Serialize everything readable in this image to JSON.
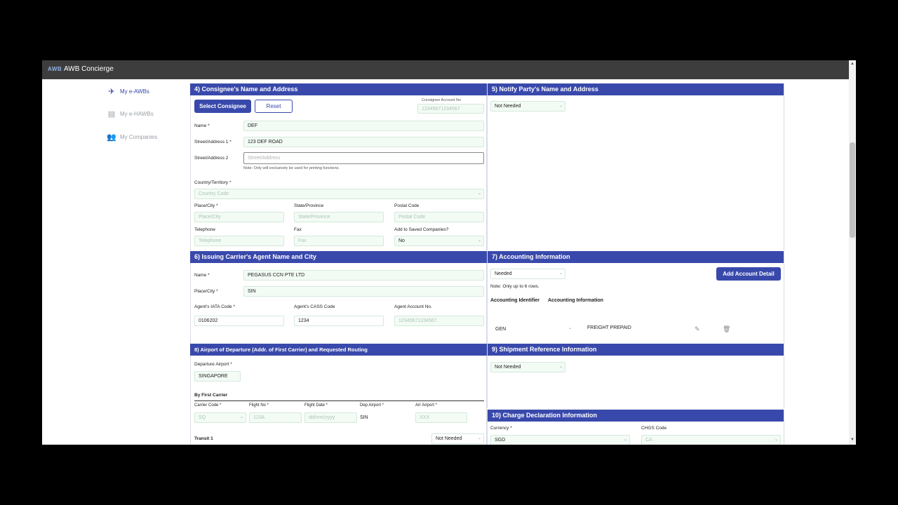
{
  "app": {
    "logo": "AWB",
    "title": "AWB Concierge"
  },
  "sidebar": {
    "items": [
      {
        "label": "My e-AWBs"
      },
      {
        "label": "My e-HAWBs"
      },
      {
        "label": "My Companies"
      }
    ]
  },
  "consignee": {
    "header": "4) Consignee's Name and Address",
    "select_button": "Select Consignee",
    "reset_button": "Reset",
    "account_label": "Consignee Account No",
    "account_placeholder": "12345671234567",
    "name_label": "Name *",
    "name_value": "DEF",
    "street1_label": "Street/Address 1 *",
    "street1_value": "123 DEF ROAD",
    "street2_label": "Street/Address 2",
    "street2_placeholder": "Street/Address",
    "note": "Note: Only will exclusively be used for printing functions.",
    "country_label": "Country/Territory *",
    "country_placeholder": "Country Code",
    "place_label": "Place/City *",
    "place_placeholder": "Place/City",
    "state_label": "State/Province",
    "state_placeholder": "State/Province",
    "postal_label": "Postal Code",
    "postal_placeholder": "Postal Code",
    "telephone_label": "Telephone",
    "telephone_placeholder": "Telephone",
    "fax_label": "Fax",
    "fax_placeholder": "Fax",
    "saved_label": "Add to Saved Companies?",
    "saved_value": "No"
  },
  "notify": {
    "header": "5) Notify Party's Name and Address",
    "select_value": "Not Needed"
  },
  "agent": {
    "header": "6) Issuing Carrier's Agent Name and City",
    "name_label": "Name *",
    "name_value": "PEGASUS CCN PTE LTD",
    "place_label": "Place/City *",
    "place_value": "SIN",
    "iata_label": "Agent's IATA Code *",
    "iata_value": "0106202",
    "cass_label": "Agent's CASS Code",
    "cass_value": "1234",
    "account_label": "Agent Account No.",
    "account_placeholder": "12345671234567"
  },
  "accounting": {
    "header": "7) Accounting Information",
    "select_value": "Needed",
    "add_button": "Add Account Detail",
    "note": "Note: Only up to 6 rows.",
    "col_identifier": "Accounting Identifier",
    "col_information": "Accounting Information",
    "rows": [
      {
        "identifier": "GEN",
        "information": "FREIGHT PREPAID"
      }
    ]
  },
  "departure": {
    "header": "8) Airport of Departure (Addr. of First Carrier) and Requested Routing",
    "airport_label": "Departure Airport *",
    "airport_value": "SINGAPORE",
    "first_carrier_label": "By First Carrier",
    "carrier_code_label": "Carrier Code *",
    "carrier_code_placeholder": "SQ",
    "flight_no_label": "Flight No *",
    "flight_no_placeholder": "123A",
    "flight_date_label": "Flight Date *",
    "flight_date_placeholder": "dd/mm/yyyy",
    "dep_airport_label": "Dep Airport *",
    "dep_airport_value": "SIN",
    "arr_airport_label": "Arr Airport *",
    "arr_airport_placeholder": "XXX",
    "transit_label": "Transit 1",
    "transit_value": "Not Needed"
  },
  "shipment_ref": {
    "header": "9) Shipment Reference Information",
    "select_value": "Not Needed"
  },
  "charge": {
    "header": "10) Charge Declaration Information",
    "currency_label": "Currency *",
    "currency_value": "SGD",
    "chgs_label": "CHGS Code",
    "chgs_placeholder": "CA"
  },
  "colors": {
    "accent": "#3949ab",
    "field_bg": "#f3fbf5",
    "titlebar": "#3d3d3d"
  }
}
